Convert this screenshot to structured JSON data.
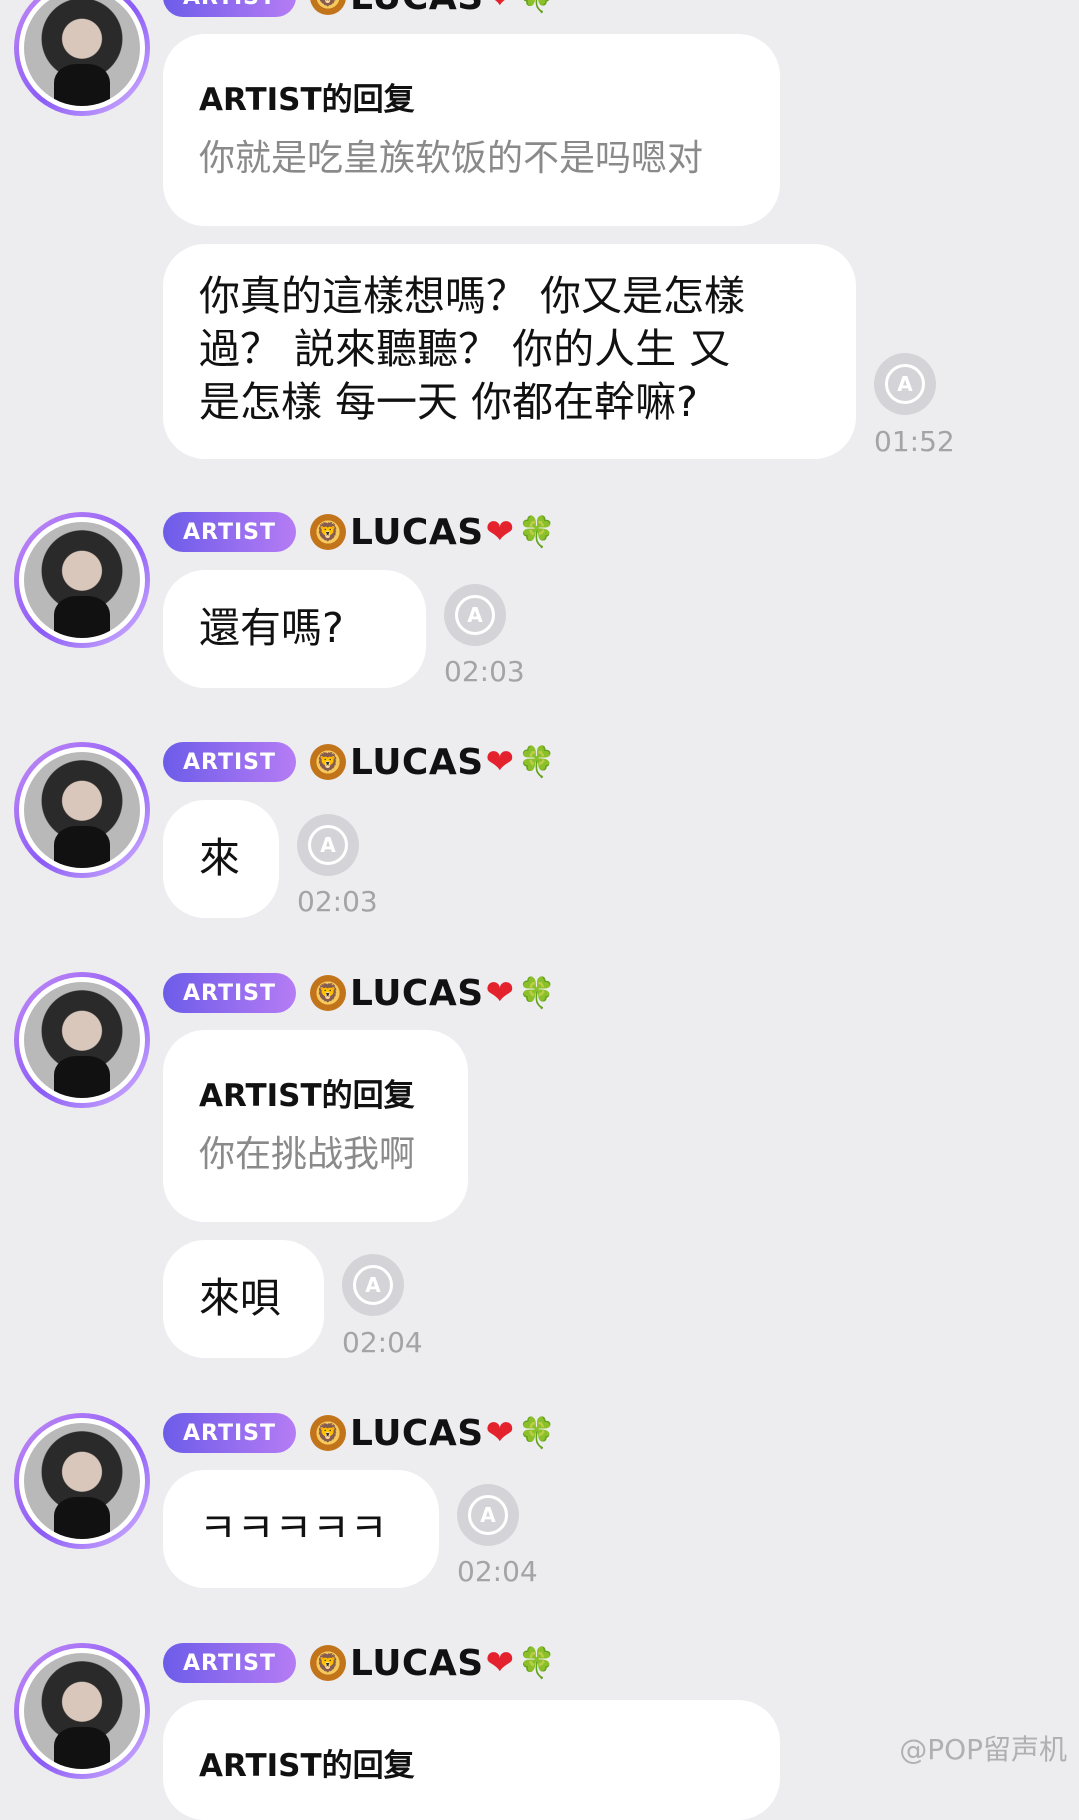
{
  "user": {
    "badge": "ARTIST",
    "name": "LUCAS",
    "lion_emoji": "🦁",
    "heart_emoji": "❤",
    "clover_emoji": "🍀"
  },
  "messages": [
    {
      "reply_title": "ARTIST的回复",
      "reply_quote": "你就是吃皇族软饭的不是吗嗯对"
    },
    {
      "lines": [
        "你真的這樣想嗎？ 你又是怎樣",
        "過？ 説來聽聽？ 你的人生 又",
        "是怎樣 每一天 你都在幹嘛?"
      ],
      "time": "01:52"
    },
    {
      "text": "還有嗎?",
      "time": "02:03"
    },
    {
      "text": "來",
      "time": "02:03"
    },
    {
      "reply_title": "ARTIST的回复",
      "reply_quote": "你在挑战我啊"
    },
    {
      "text": "來唄",
      "time": "02:04"
    },
    {
      "text": "ㅋㅋㅋㅋㅋ",
      "time": "02:04"
    },
    {
      "reply_title": "ARTIST的回复"
    }
  ],
  "translate_icon": {
    "icon": "translate-icon",
    "glyph": "A"
  },
  "watermark": "@POP留声机"
}
